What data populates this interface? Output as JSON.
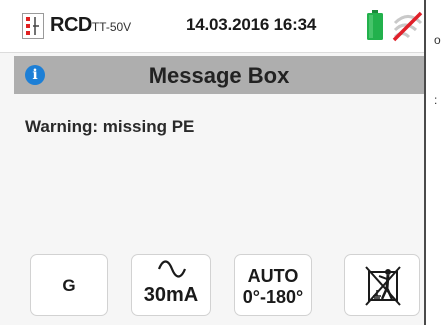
{
  "status_bar": {
    "function_name": "RCD",
    "function_sub": "TT-50V",
    "datetime": "14.03.2016  16:34",
    "battery_color": "#22b14c",
    "icons": [
      "rcd-icon",
      "battery-icon",
      "wifi-icon"
    ]
  },
  "title_bar": {
    "title": "Message Box",
    "info_glyph": "i",
    "background": "#aeaeae"
  },
  "message": {
    "text": "Warning: missing PE"
  },
  "edge_markers": [
    "o",
    ":"
  ],
  "buttons": [
    {
      "label": "G"
    },
    {
      "label": "30mA",
      "icon": "sine-wave-icon"
    },
    {
      "line1": "AUTO",
      "line2": "0°-180°"
    },
    {
      "icon": "pe-disabled-icon"
    }
  ]
}
